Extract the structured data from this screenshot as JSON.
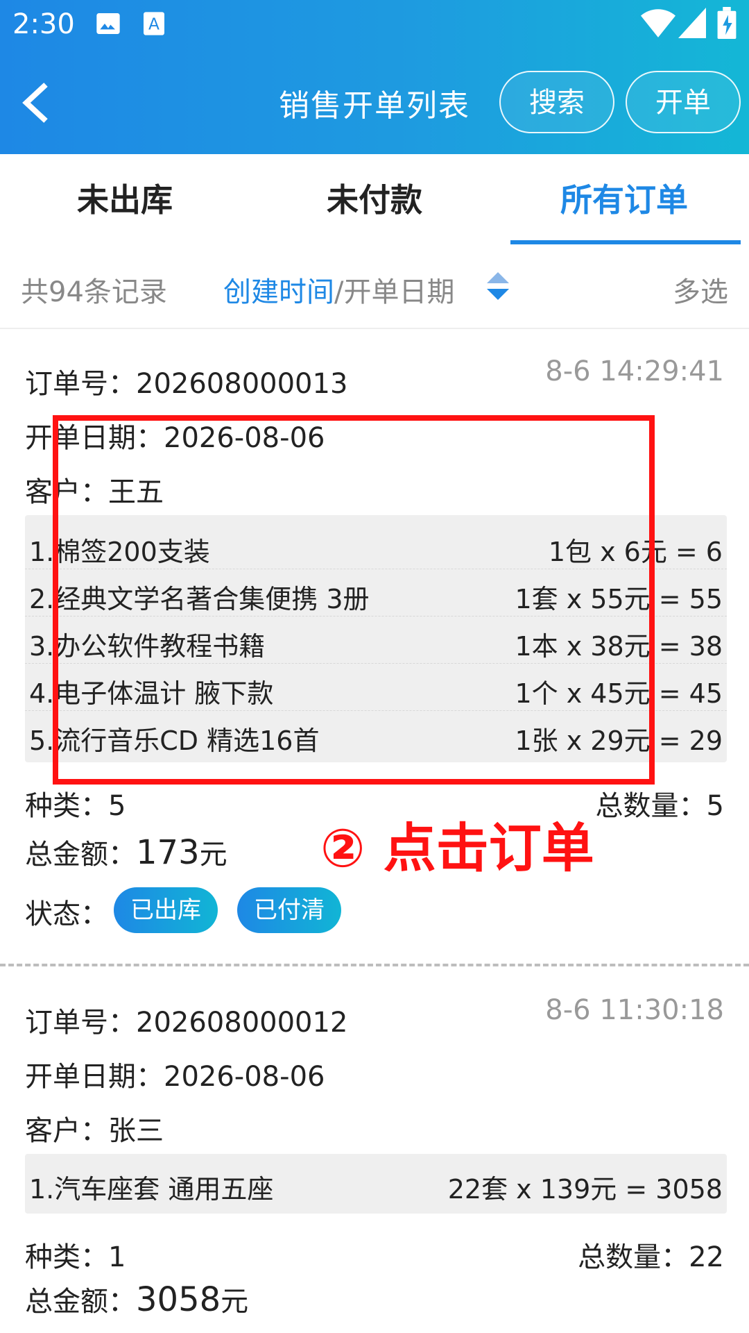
{
  "status_bar": {
    "time": "2:30",
    "icons": [
      "image-icon",
      "a-icon",
      "wifi-icon",
      "cell-signal-icon",
      "battery-icon"
    ]
  },
  "header": {
    "title": "销售开单列表",
    "search_label": "搜索",
    "open_label": "开单"
  },
  "tabs": [
    {
      "label": "未出库"
    },
    {
      "label": "未付款"
    },
    {
      "label": "所有订单",
      "active": true
    }
  ],
  "sort_bar": {
    "count_text": "共94条记录",
    "sort_active": "创建时间",
    "sort_separator": "/",
    "sort_other": "开单日期",
    "multi_select": "多选"
  },
  "orders": [
    {
      "order_no_label": "订单号：",
      "order_no": "202608000013",
      "timestamp": "8-6 14:29:41",
      "date_label": "开单日期：",
      "date": "2026-08-06",
      "customer_label": "客户：",
      "customer": "王五",
      "items": [
        {
          "name": "1.棉签200支装",
          "calc": "1包 x 6元 = 6"
        },
        {
          "name": "2.经典文学名著合集便携 3册",
          "calc": "1套 x 55元 = 55"
        },
        {
          "name": "3.办公软件教程书籍",
          "calc": "1本 x 38元 = 38"
        },
        {
          "name": "4.电子体温计 腋下款",
          "calc": "1个 x 45元 = 45"
        },
        {
          "name": "5.流行音乐CD 精选16首",
          "calc": "1张 x 29元 = 29"
        }
      ],
      "kinds_label": "种类：",
      "kinds": "5",
      "qty_label": "总数量：",
      "qty": "5",
      "amount_label": "总金额：",
      "amount": "173",
      "amount_unit": "元",
      "status_label": "状态：",
      "badges": [
        "已出库",
        "已付清"
      ]
    },
    {
      "order_no_label": "订单号：",
      "order_no": "202608000012",
      "timestamp": "8-6 11:30:18",
      "date_label": "开单日期：",
      "date": "2026-08-06",
      "customer_label": "客户：",
      "customer": "张三",
      "items": [
        {
          "name": "1.汽车座套 通用五座",
          "calc": "22套 x 139元 = 3058"
        }
      ],
      "kinds_label": "种类：",
      "kinds": "1",
      "qty_label": "总数量：",
      "qty": "22",
      "amount_label": "总金额：",
      "amount": "3058",
      "amount_unit": "元"
    }
  ],
  "annotation": {
    "text": "② 点击订单",
    "color": "#ff1212"
  },
  "colors": {
    "accent": "#1e88e5",
    "header_gradient_end": "#14b7d6"
  }
}
